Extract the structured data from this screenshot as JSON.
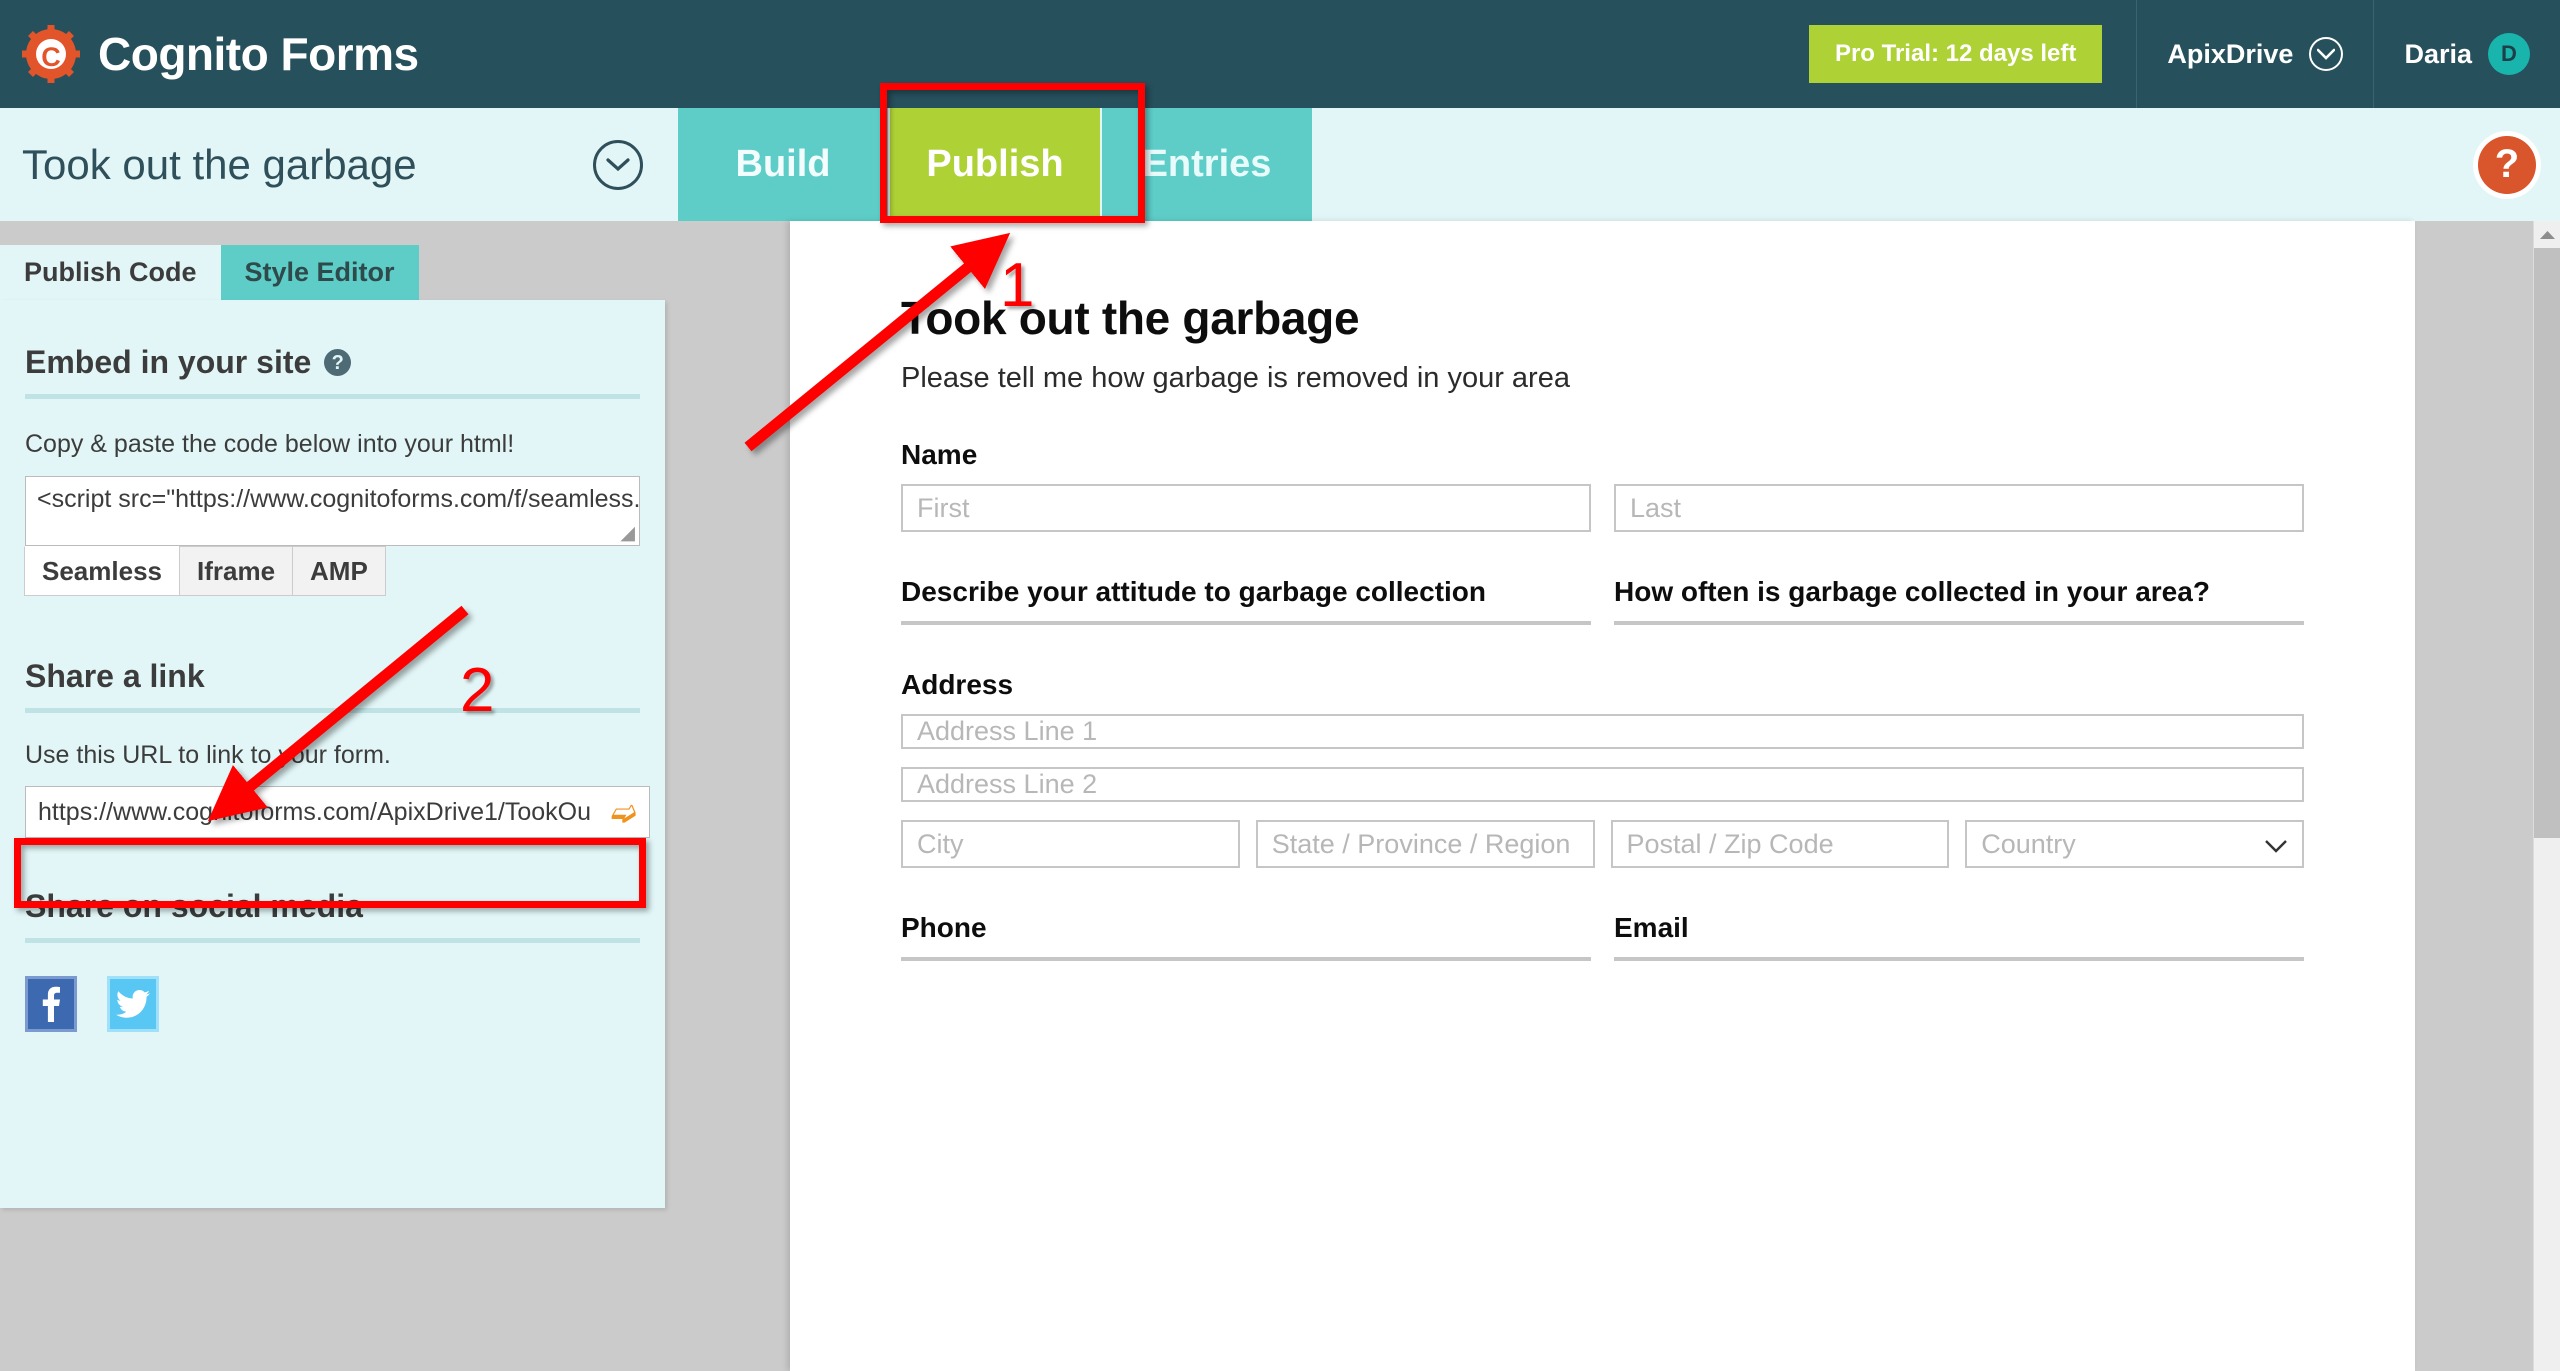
{
  "app": {
    "brand": "Cognito Forms",
    "logo_icon": "gear-c-icon",
    "trial_badge": "Pro Trial: 12 days left",
    "org": {
      "name": "ApixDrive",
      "chevron_icon": "chevron-down-circle-icon"
    },
    "user": {
      "name": "Daria",
      "initial": "D"
    }
  },
  "titlebar": {
    "form_title": "Took out the garbage",
    "expand_icon": "chevron-down-circle-icon",
    "tabs": [
      {
        "label": "Build",
        "active": false
      },
      {
        "label": "Publish",
        "active": true
      },
      {
        "label": "Entries",
        "active": false
      }
    ],
    "help_icon": "question-mark-icon",
    "help_label": "?"
  },
  "panel": {
    "tabs": [
      {
        "label": "Publish Code",
        "selected": false
      },
      {
        "label": "Style Editor",
        "selected": true
      }
    ],
    "embed": {
      "heading": "Embed in your site",
      "help_icon": "question-mark-icon",
      "instruction": "Copy & paste the code below into your html!",
      "code_value": "<script src=\"https://www.cognitoforms.com/f/seamless.j",
      "embed_types": [
        {
          "label": "Seamless",
          "selected": true
        },
        {
          "label": "Iframe",
          "selected": false
        },
        {
          "label": "AMP",
          "selected": false
        }
      ]
    },
    "share_link": {
      "heading": "Share a link",
      "instruction": "Use this URL to link to your form.",
      "url_value": "https://www.cognitoforms.com/ApixDrive1/TookOu",
      "share_icon": "share-arrow-icon"
    },
    "social": {
      "heading": "Share on social media",
      "buttons": [
        {
          "name": "facebook",
          "glyph": "f",
          "color": "#3d69b1"
        },
        {
          "name": "twitter",
          "glyph": "twitter-bird-icon",
          "color": "#59c7f4"
        }
      ]
    }
  },
  "form_preview": {
    "title": "Took out the garbage",
    "description": "Please tell me how garbage is removed in your area",
    "fields": [
      {
        "label": "Name",
        "inputs": [
          {
            "placeholder": "First"
          },
          {
            "placeholder": "Last"
          }
        ]
      },
      {
        "columns": [
          {
            "label": "Describe your attitude to garbage collection",
            "placeholder": ""
          },
          {
            "label": "How often is garbage collected in your area?",
            "placeholder": ""
          }
        ]
      },
      {
        "label": "Address",
        "lines": [
          {
            "placeholder": "Address Line 1"
          },
          {
            "placeholder": "Address Line 2"
          }
        ],
        "sub": [
          {
            "placeholder": "City"
          },
          {
            "placeholder": "State / Province / Region"
          },
          {
            "placeholder": "Postal / Zip Code"
          },
          {
            "placeholder": "Country",
            "type": "select",
            "chevron_icon": "chevron-down-icon"
          }
        ]
      },
      {
        "columns": [
          {
            "label": "Phone",
            "placeholder": ""
          },
          {
            "label": "Email",
            "placeholder": ""
          }
        ]
      }
    ]
  },
  "annotations": {
    "step1": "1",
    "step2": "2"
  },
  "colors": {
    "header_bg": "#26505c",
    "accent_green": "#aed136",
    "accent_teal": "#5ecdc8",
    "panel_bg": "#e2f6f7",
    "orange": "#d9552b",
    "annotation_red": "#ff0000"
  }
}
